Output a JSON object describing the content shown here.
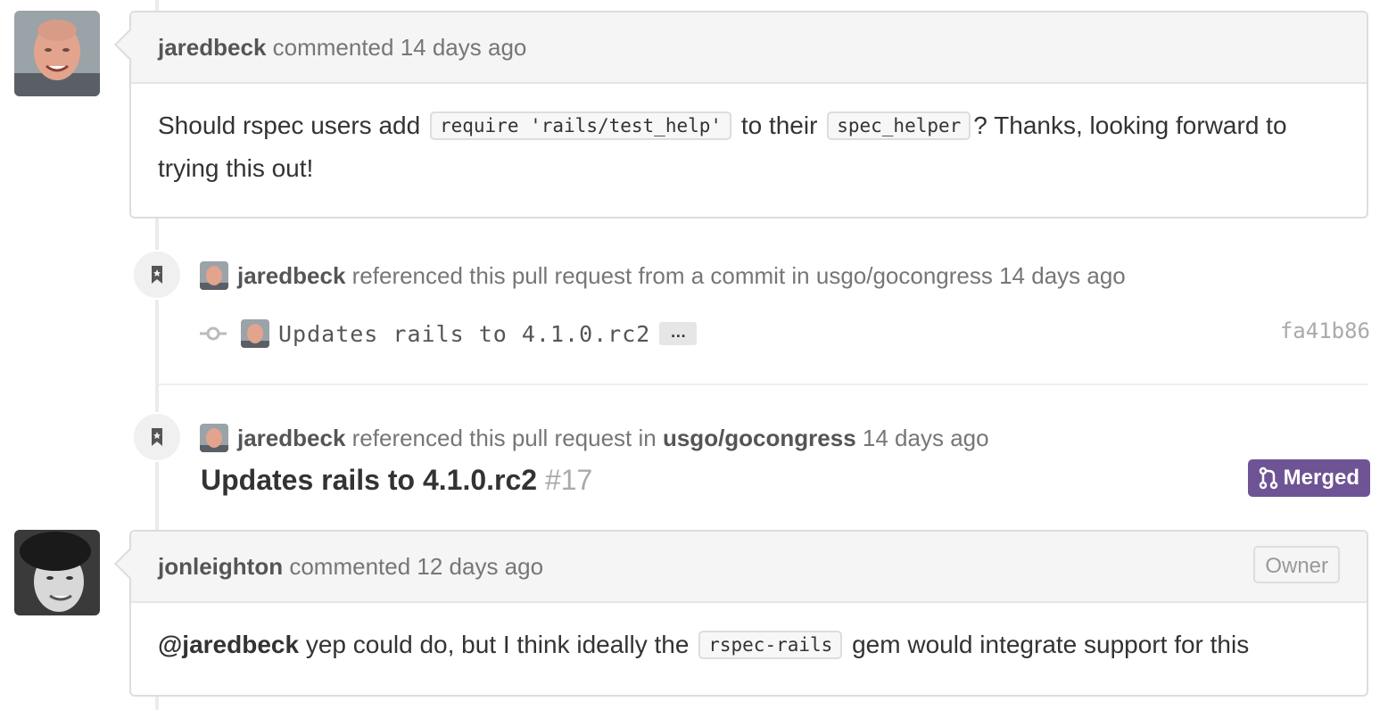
{
  "comments": [
    {
      "author": "jaredbeck",
      "action": "commented 14 days ago",
      "body_parts": [
        "Should rspec users add",
        "require 'rails/test_help'",
        "to their",
        "spec_helper",
        "? Thanks, looking forward to trying this out!"
      ]
    },
    {
      "author": "jonleighton",
      "action": "commented 12 days ago",
      "badge": "Owner",
      "body_parts": [
        "@jaredbeck",
        "yep could do, but I think ideally the",
        "rspec-rails",
        "gem would integrate support for this"
      ]
    }
  ],
  "events": [
    {
      "author": "jaredbeck",
      "text": "referenced this pull request from a commit in usgo/gocongress 14 days ago",
      "commit": {
        "message": "Updates rails to 4.1.0.rc2",
        "ellipsis": "…",
        "sha": "fa41b86"
      }
    },
    {
      "author": "jaredbeck",
      "text_before": "referenced this pull request in",
      "repo": "usgo/gocongress",
      "time": "14 days ago",
      "pr": {
        "title": "Updates rails to 4.1.0.rc2",
        "number": "#17",
        "state": "Merged"
      }
    }
  ],
  "colors": {
    "merged": "#6e5494",
    "timeline": "#ebebeb"
  },
  "icons": [
    "bookmark-icon",
    "git-commit-icon",
    "git-merge-icon"
  ]
}
